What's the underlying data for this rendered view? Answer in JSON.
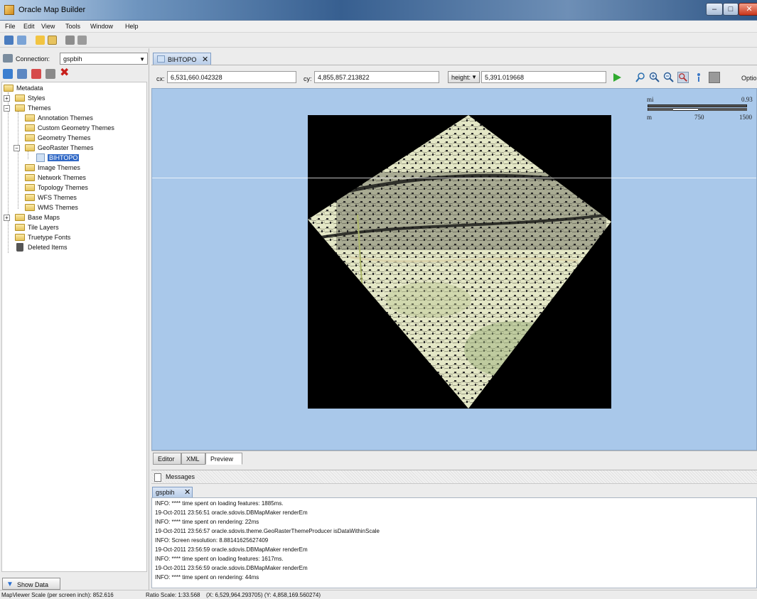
{
  "window": {
    "title": "Oracle Map Builder",
    "min": "–",
    "max": "□",
    "close": "✕"
  },
  "menu": [
    "File",
    "Edit",
    "View",
    "Tools",
    "Window",
    "Help"
  ],
  "left": {
    "connection_label": "Connection:",
    "connection_value": "gspbih",
    "tree": {
      "metadata": "Metadata",
      "styles": "Styles",
      "themes": "Themes",
      "annotation": "Annotation Themes",
      "custom_geometry": "Custom Geometry Themes",
      "geometry": "Geometry Themes",
      "georaster": "GeoRaster Themes",
      "bihtopo": "BIHTOPO",
      "image": "Image Themes",
      "network": "Network Themes",
      "topology": "Topology Themes",
      "wfs": "WFS Themes",
      "wms": "WMS Themes",
      "base_maps": "Base Maps",
      "tile_layers": "Tile Layers",
      "truetype": "Truetype Fonts",
      "deleted": "Deleted Items"
    },
    "show_data": "Show Data"
  },
  "editor": {
    "tab_label": "BIHTOPO",
    "cx_label": "cx:",
    "cx_value": "6,531,660.042328",
    "cy_label": "cy:",
    "cy_value": "4,855,857.213822",
    "height_select": "height:",
    "height_value": "5,391.019668",
    "options": "Optio"
  },
  "scalebar": {
    "mi": "mi",
    "mi_val": "0.93",
    "m": "m",
    "m_mid": "750",
    "m_max": "1500"
  },
  "bottom_tabs": [
    "Editor",
    "XML",
    "Preview"
  ],
  "messages": {
    "title": "Messages",
    "tab": "gspbih",
    "lines": [
      "INFO:  **** time spent on loading features: 1885ms.",
      "19-Oct-2011 23:56:51 oracle.sdovis.DBMapMaker renderEm",
      "INFO:  **** time spent on rendering: 22ms",
      "19-Oct-2011 23:56:57 oracle.sdovis.theme.GeoRasterThemeProducer isDataWithinScale",
      "INFO: Screen resolution: 8.88141625627409",
      "19-Oct-2011 23:56:59 oracle.sdovis.DBMapMaker renderEm",
      "INFO:  **** time spent on loading features: 1617ms.",
      "19-Oct-2011 23:56:59 oracle.sdovis.DBMapMaker renderEm",
      "INFO:  **** time spent on rendering: 44ms"
    ]
  },
  "status": {
    "scale": "MapViewer Scale (per screen inch): 852.616",
    "ratio": "Ratio Scale: 1:33.568",
    "coords": "(X: 6,529,964.293705) (Y: 4,858,169.560274)"
  },
  "colors": {
    "map_bg": "#a9c8ea",
    "selection": "#3169c6",
    "raster_bg": "#000000"
  }
}
